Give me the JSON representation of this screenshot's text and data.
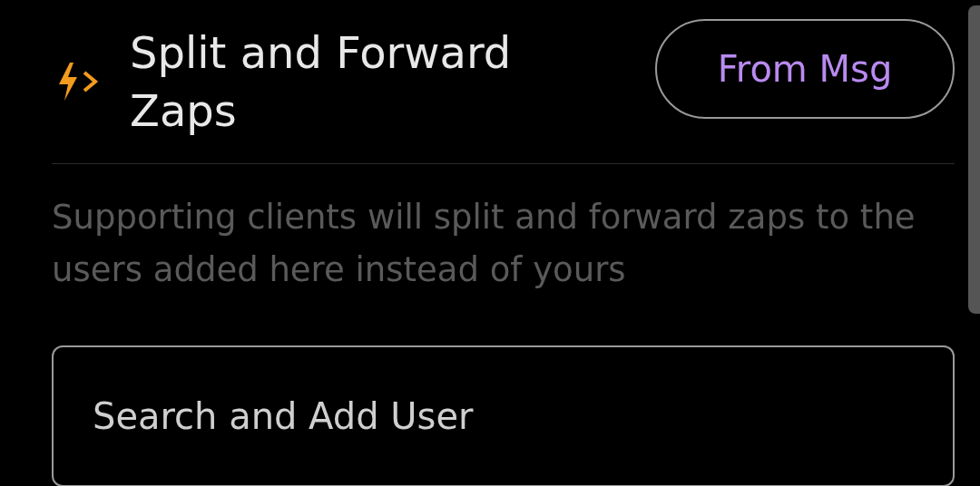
{
  "header": {
    "title": "Split and Forward Zaps",
    "button": "From Msg"
  },
  "description": "Supporting clients will split and forward zaps to the users added here instead of yours",
  "search": {
    "placeholder": "Search and Add User"
  }
}
